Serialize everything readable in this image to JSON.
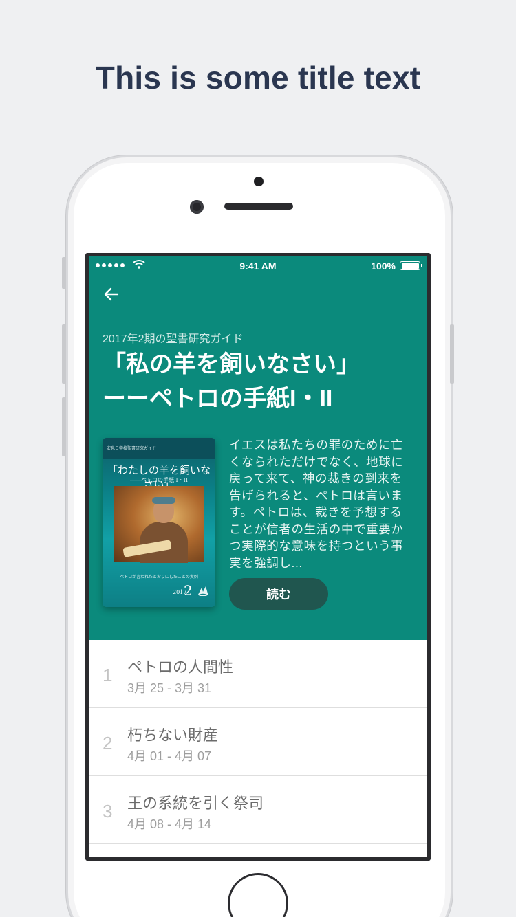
{
  "headline": "This is some title text",
  "status_bar": {
    "time": "9:41 AM",
    "battery": "100%"
  },
  "guide": {
    "label": "2017年2期の聖書研究ガイド",
    "title_line1": "「私の羊を飼いなさい」",
    "title_line2": "ーーペトロの手紙I・II",
    "description": "イエスは私たちの罪のために亡くなられただけでなく、地球に戻って来て、神の裁きの到来を告げられると、ペトロは言います。ペトロは、裁きを予想することが信者の生活の中で重要かつ実際的な意味を持つという事実を強調し...",
    "read_button": "読む"
  },
  "cover": {
    "kicker": "安息日学校聖書研究ガイド",
    "title": "「わたしの羊を飼いなさい」",
    "subtitle": "――ペトロの手紙 I・II",
    "caption": "ペトロが言われたとおりにしたことの実例",
    "year": "2017",
    "quarter": "2"
  },
  "lessons": [
    {
      "number": "1",
      "title": "ペトロの人間性",
      "dates": "3月 25 - 3月 31"
    },
    {
      "number": "2",
      "title": "朽ちない財産",
      "dates": "4月 01 - 4月 07"
    },
    {
      "number": "3",
      "title": "王の系統を引く祭司",
      "dates": "4月 08 - 4月 14"
    }
  ],
  "colors": {
    "hero": "#0b8a7c",
    "read_button": "#20564f",
    "headline": "#2a3650",
    "background": "#eff0f2"
  },
  "icons": [
    "signal-icon",
    "wifi-icon",
    "battery-icon",
    "back-arrow-icon",
    "adventist-logo-icon"
  ]
}
